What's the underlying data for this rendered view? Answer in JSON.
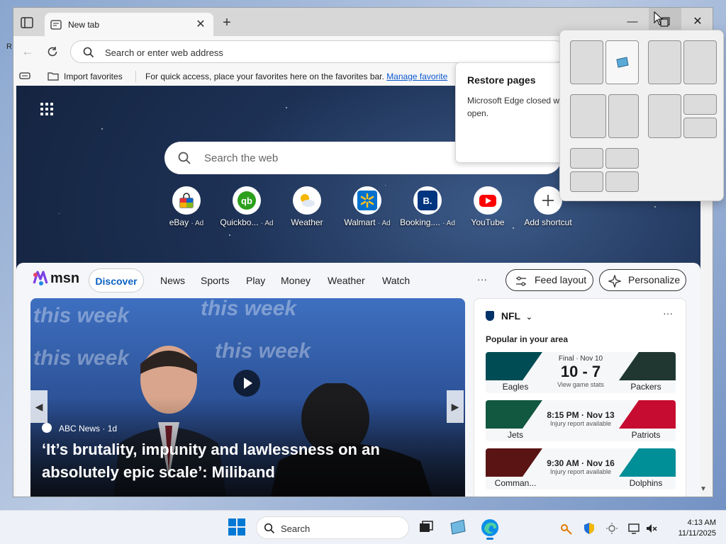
{
  "desktop": {
    "letter_r": "R"
  },
  "browser": {
    "tab": {
      "title": "New tab"
    },
    "address": {
      "placeholder": "Search or enter web address"
    },
    "favorites_bar": {
      "import": "Import favorites",
      "message": "For quick access, place your favorites here on the favorites bar.",
      "manage_link": "Manage favorite"
    },
    "restore": {
      "title": "Restore pages",
      "body": "Microsoft Edge closed w open."
    }
  },
  "ntp": {
    "search_placeholder": "Search the web",
    "shortcuts": [
      {
        "name": "eBay",
        "ad": "· Ad",
        "icon": "ebay-icon",
        "color": "#e53238"
      },
      {
        "name": "Quickbo...",
        "ad": "· Ad",
        "icon": "quickbooks-icon",
        "color": "#2ca01c"
      },
      {
        "name": "Weather",
        "ad": "",
        "icon": "weather-icon",
        "color": "#f5b700"
      },
      {
        "name": "Walmart",
        "ad": "· Ad",
        "icon": "walmart-icon",
        "color": "#0071ce"
      },
      {
        "name": "Booking....",
        "ad": "· Ad",
        "icon": "booking-icon",
        "color": "#003580"
      },
      {
        "name": "YouTube",
        "ad": "",
        "icon": "youtube-icon",
        "color": "#ff0000"
      },
      {
        "name": "Add shortcut",
        "ad": "",
        "icon": "plus-icon",
        "color": "#333333"
      }
    ]
  },
  "feed": {
    "logo": "msn",
    "nav": [
      "Discover",
      "News",
      "Sports",
      "Play",
      "Money",
      "Weather",
      "Watch"
    ],
    "more": "···",
    "feed_layout": "Feed layout",
    "personalize": "Personalize",
    "hero": {
      "source": "ABC News",
      "age": "· 1d",
      "headline": "‘It’s brutality, impunity and lawlessness on an absolutely epic scale’: Miliband",
      "bg_word": "this week"
    },
    "nfl": {
      "title": "NFL",
      "subtitle": "Popular in your area",
      "more": "···",
      "games": [
        {
          "home": "Eagles",
          "away": "Packers",
          "status": "Final · Nov 10",
          "score": "10 - 7",
          "note": "View game stats",
          "home_color": "#004c54",
          "away_color": "#203731"
        },
        {
          "home": "Jets",
          "away": "Patriots",
          "time": "8:15 PM · Nov 13",
          "note": "Injury report available",
          "home_color": "#125740",
          "away_color": "#c60c30"
        },
        {
          "home": "Comman...",
          "away": "Dolphins",
          "time": "9:30 AM · Nov 16",
          "note": "Injury report available",
          "home_color": "#5a1414",
          "away_color": "#008e97"
        }
      ]
    }
  },
  "taskbar": {
    "search_placeholder": "Search",
    "time": "4:13 AM",
    "date": "11/11/2025"
  }
}
